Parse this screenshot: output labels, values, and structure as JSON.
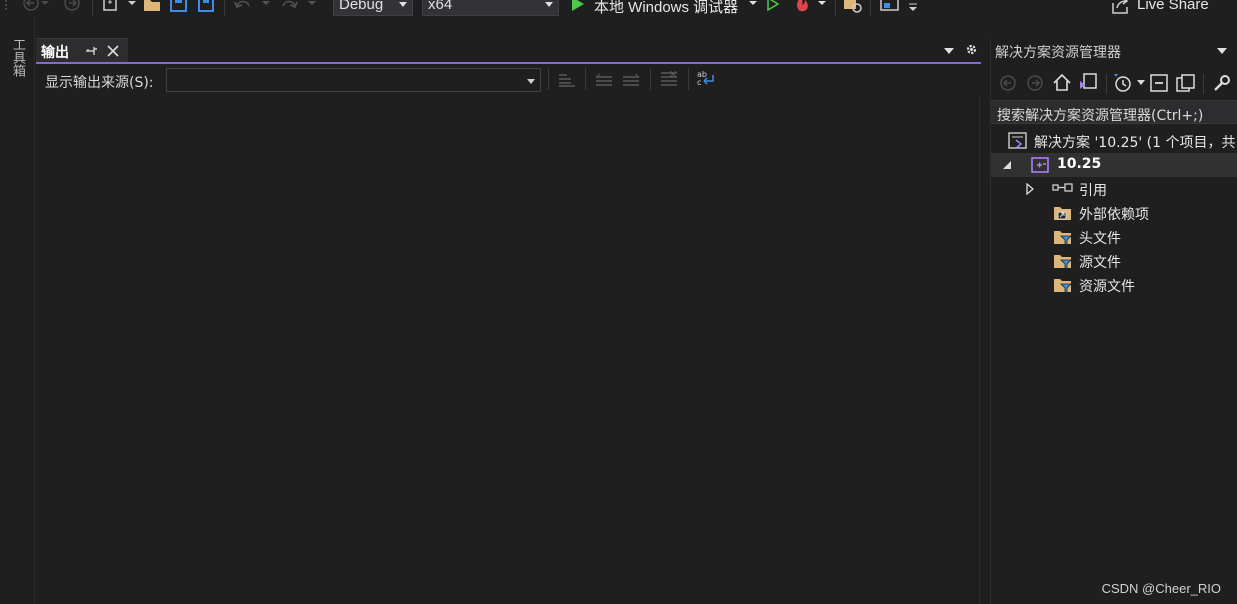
{
  "toolbar": {
    "config": "Debug",
    "platform": "x64",
    "debugger": "本地 Windows 调试器",
    "live_share": "Live Share"
  },
  "toolbox": {
    "label": "工具箱"
  },
  "output_panel": {
    "tab_title": "输出",
    "source_label": "显示输出来源(S):",
    "source_value": ""
  },
  "solution_explorer": {
    "title": "解决方案资源管理器",
    "search_placeholder": "搜索解决方案资源管理器(Ctrl+;)",
    "solution": "解决方案 '10.25' (1 个项目，共",
    "project": "10.25",
    "items": [
      {
        "label": "引用",
        "icon": "references-icon"
      },
      {
        "label": "外部依赖项",
        "icon": "external-deps-folder-icon"
      },
      {
        "label": "头文件",
        "icon": "filter-folder-icon"
      },
      {
        "label": "源文件",
        "icon": "filter-folder-icon"
      },
      {
        "label": "资源文件",
        "icon": "filter-folder-icon"
      }
    ]
  },
  "watermark": "CSDN @Cheer_RIO",
  "colors": {
    "accent": "#8867d9",
    "run_green": "#4ec94e",
    "folder": "#dcb67a"
  }
}
